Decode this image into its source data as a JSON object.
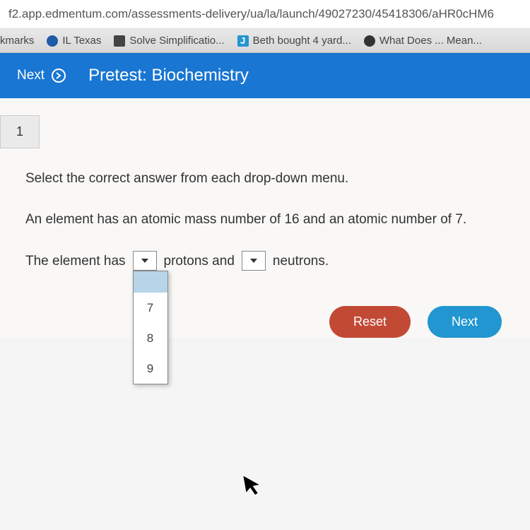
{
  "url": "f2.app.edmentum.com/assessments-delivery/ua/la/launch/49027230/45418306/aHR0cHM6",
  "browser_tabs": {
    "t0": "kmarks",
    "t1": "IL Texas",
    "t2": "Solve Simplificatio...",
    "t3_icon": "J",
    "t3": "Beth bought 4 yard...",
    "t4": "What Does ... Mean..."
  },
  "header": {
    "next": "Next",
    "title": "Pretest: Biochemistry"
  },
  "question": {
    "number": "1",
    "instruction": "Select the correct answer from each drop-down menu.",
    "problem": "An element has an atomic mass number of 16 and an atomic number of 7.",
    "line_part1": "The element has",
    "line_part2": "protons and",
    "line_part3": "neutrons.",
    "dropdown1_options": {
      "o1": "7",
      "o2": "8",
      "o3": "9"
    }
  },
  "buttons": {
    "reset": "Reset",
    "next": "Next"
  }
}
